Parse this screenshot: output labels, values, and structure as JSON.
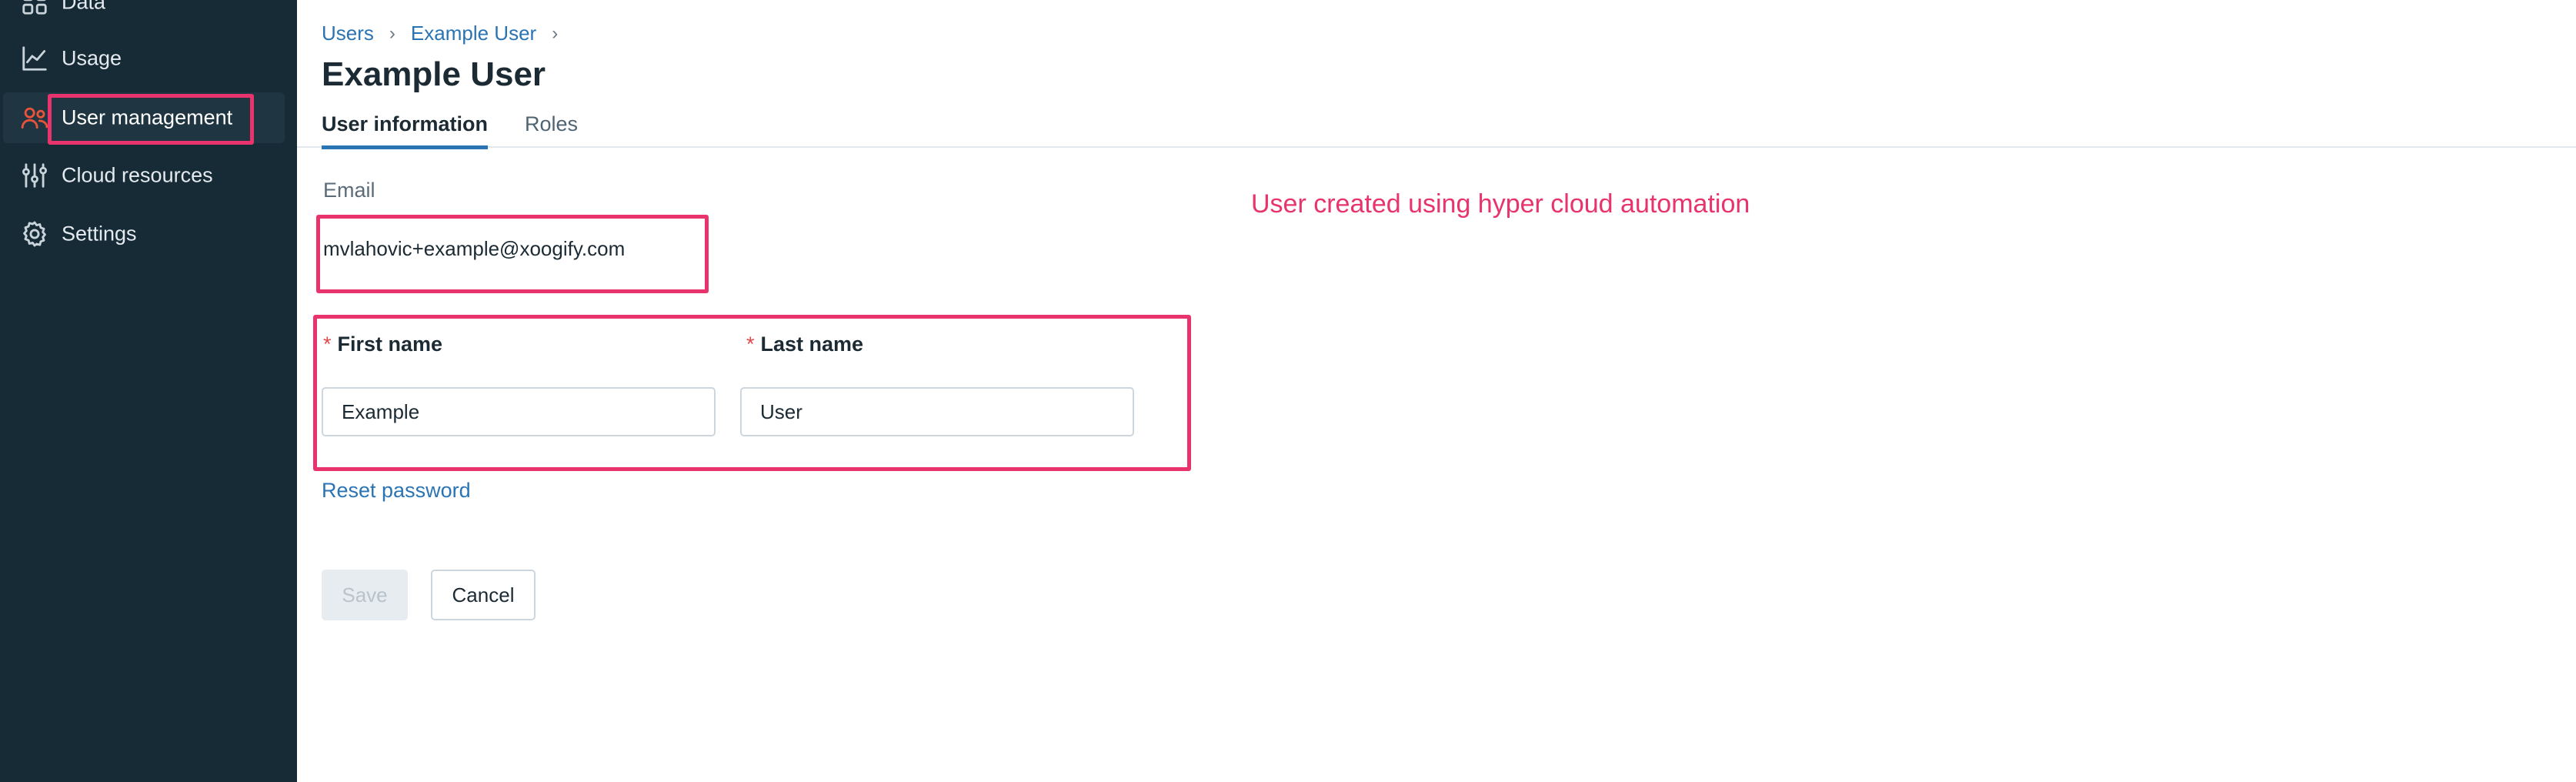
{
  "sidebar": {
    "items": [
      {
        "label": "Data",
        "icon": "data-icon"
      },
      {
        "label": "Usage",
        "icon": "chart-line-icon"
      },
      {
        "label": "User management",
        "icon": "users-icon",
        "active": true
      },
      {
        "label": "Cloud resources",
        "icon": "sliders-icon"
      },
      {
        "label": "Settings",
        "icon": "gear-icon"
      }
    ]
  },
  "breadcrumb": {
    "items": [
      "Users",
      "Example User"
    ],
    "separator": "›"
  },
  "page": {
    "title": "Example User"
  },
  "tabs": [
    {
      "label": "User information",
      "active": true
    },
    {
      "label": "Roles",
      "active": false
    }
  ],
  "form": {
    "email_label": "Email",
    "email_value": "mvlahovic+example@xoogify.com",
    "required_mark": "*",
    "first_name_label": "First name",
    "first_name_value": "Example",
    "last_name_label": "Last name",
    "last_name_value": "User",
    "reset_password": "Reset password",
    "save_label": "Save",
    "cancel_label": "Cancel"
  },
  "annotation": {
    "note": "User created using hyper cloud automation"
  },
  "colors": {
    "sidebar_bg": "#172b36",
    "accent": "#2b74b3",
    "annotation": "#e8336c",
    "active_icon": "#e8533a"
  }
}
